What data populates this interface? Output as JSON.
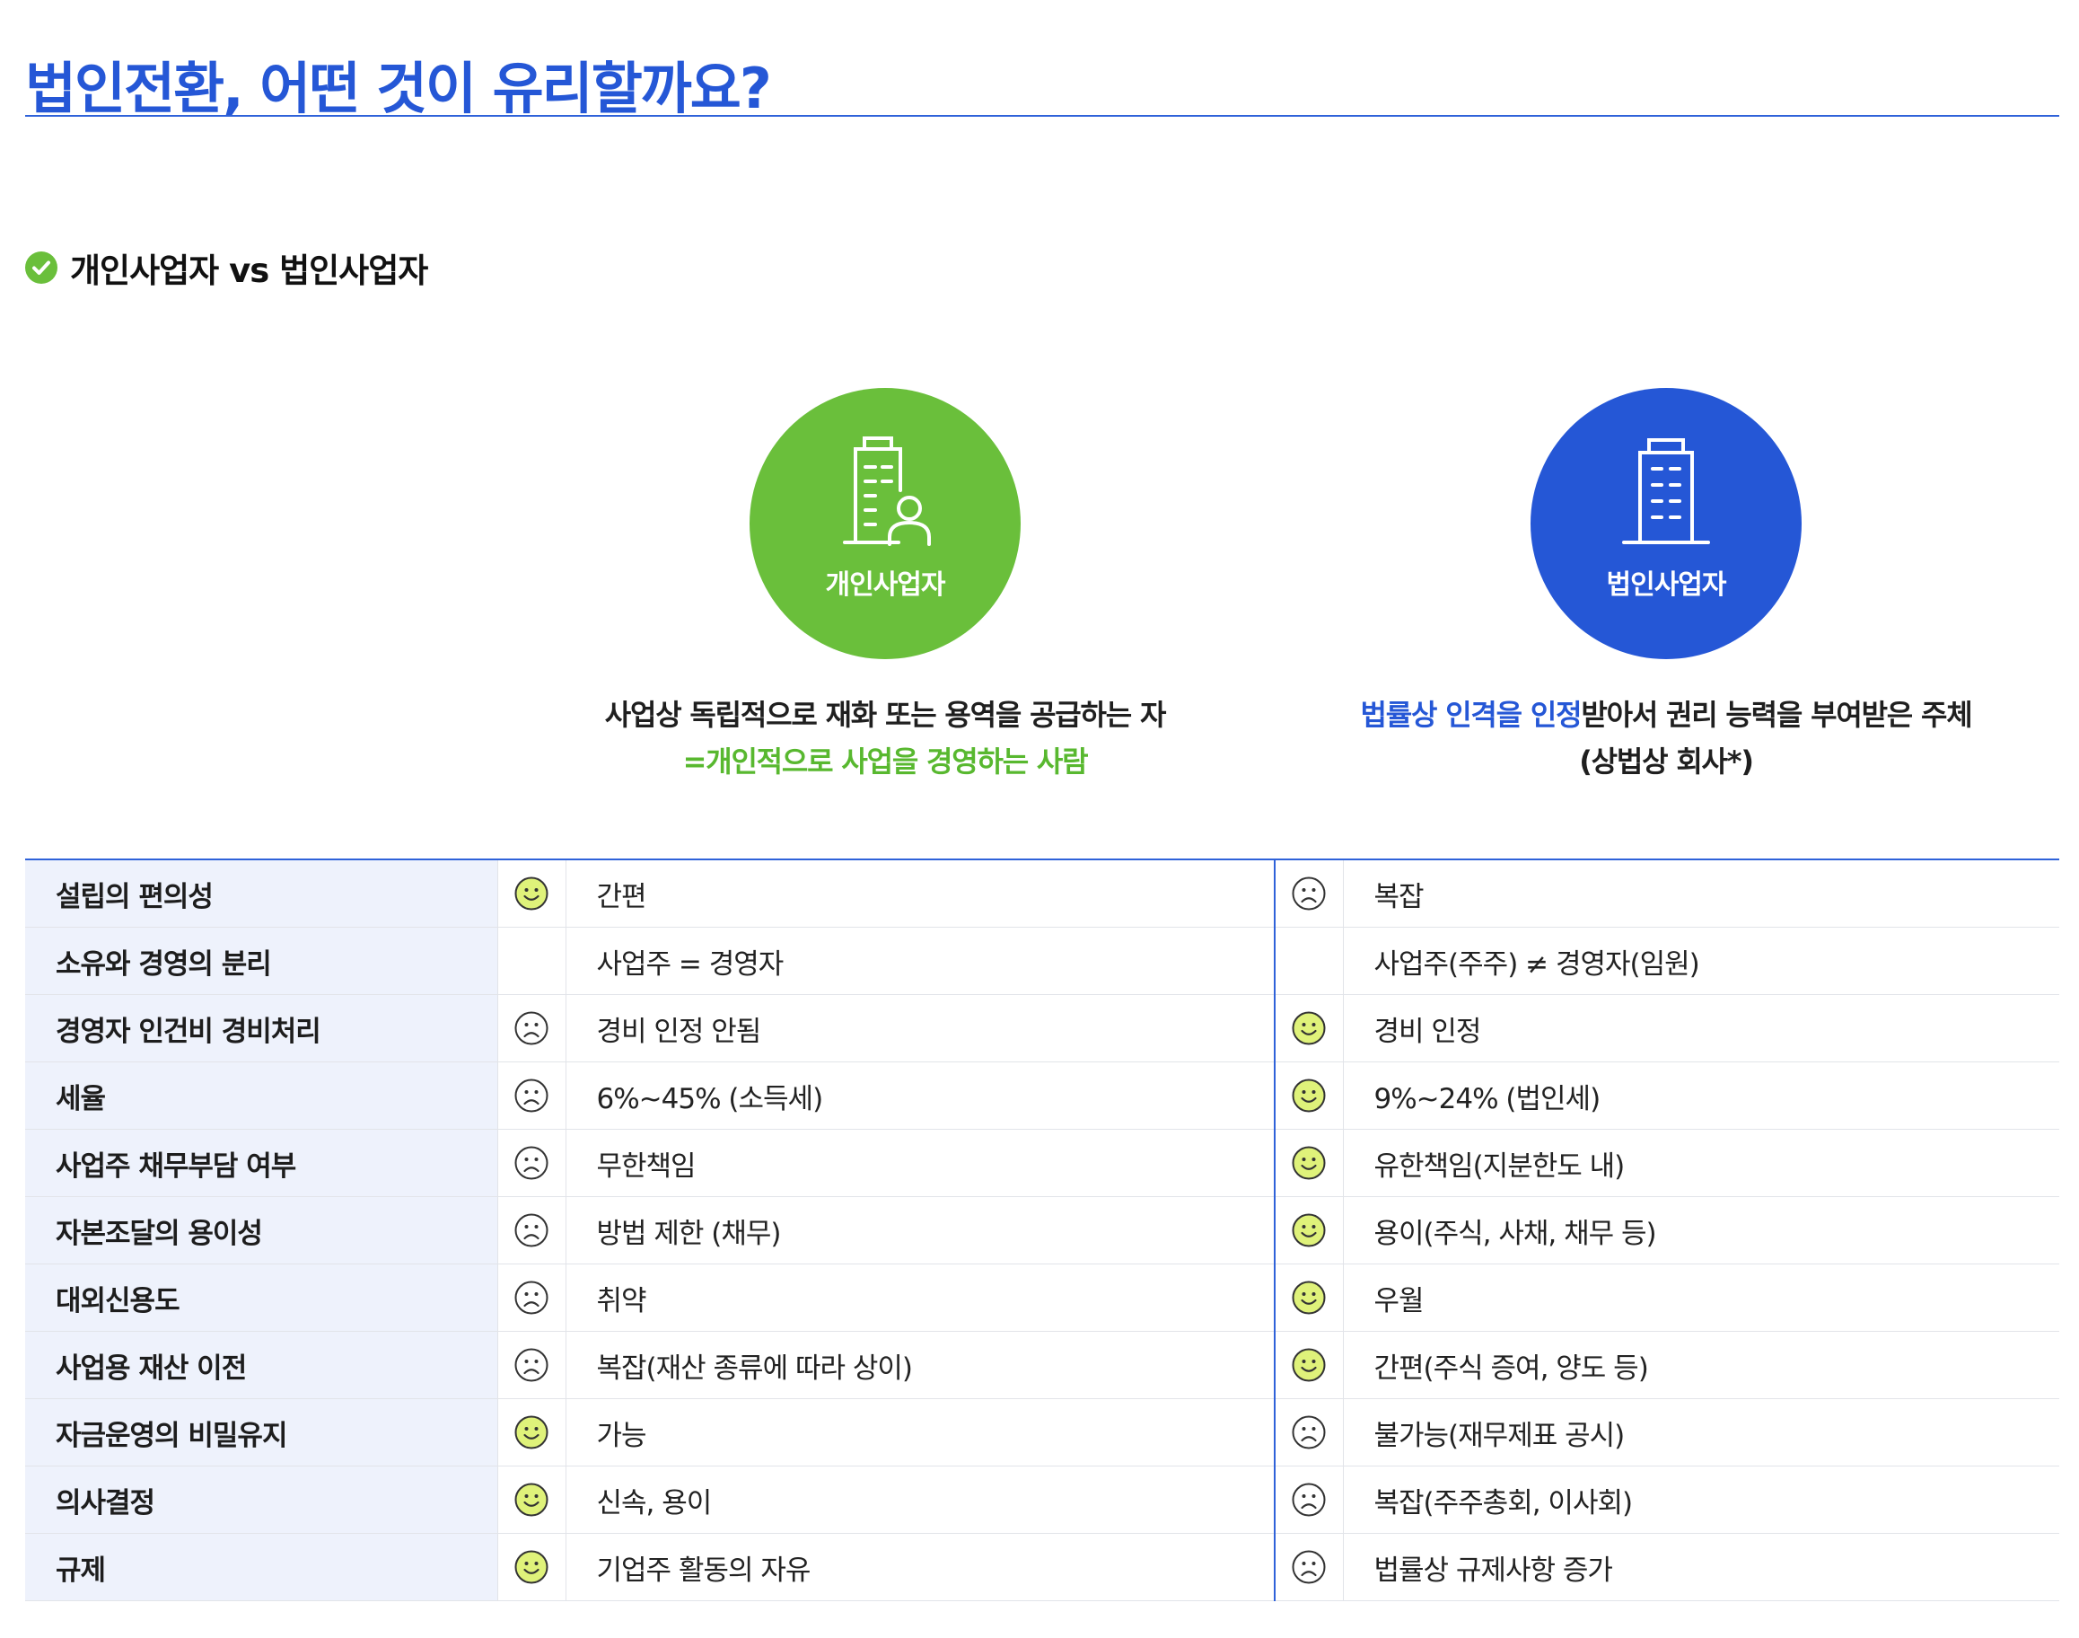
{
  "page": {
    "title": "법인전환, 어떤 것이 유리할까요?",
    "section_heading": "개인사업자 vs 법인사업자"
  },
  "colors": {
    "primary_blue": "#2557d6",
    "green": "#6abf3b",
    "label_background": "#eef2fc",
    "face_yellow": "#dff27a"
  },
  "individual": {
    "circle_label": "개인사업자",
    "icon": "building-with-person-icon",
    "description_line1": "사업상 독립적으로 재화 또는 용역을 공급하는 자",
    "description_line2": "=개인적으로 사업을 경영하는 사람"
  },
  "corporate": {
    "circle_label": "법인사업자",
    "icon": "office-building-icon",
    "description_highlight": "법률상 인격을 인정",
    "description_rest": "받아서 권리 능력을 부여받은 주체",
    "description_line2": "(상법상 회사*)"
  },
  "comparison": {
    "rows": [
      {
        "label": "설립의 편의성",
        "individual_face": "happy",
        "individual": "간편",
        "corporate_face": "sad",
        "corporate": "복잡"
      },
      {
        "label": "소유와 경영의 분리",
        "individual_face": "none",
        "individual": "사업주 = 경영자",
        "corporate_face": "none",
        "corporate": "사업주(주주) ≠ 경영자(임원)"
      },
      {
        "label": "경영자 인건비 경비처리",
        "individual_face": "sad",
        "individual": "경비 인정 안됨",
        "corporate_face": "happy",
        "corporate": "경비 인정"
      },
      {
        "label": "세율",
        "individual_face": "sad",
        "individual": "6%~45% (소득세)",
        "corporate_face": "happy",
        "corporate": "9%~24% (법인세)"
      },
      {
        "label": "사업주 채무부담 여부",
        "individual_face": "sad",
        "individual": "무한책임",
        "corporate_face": "happy",
        "corporate": "유한책임(지분한도 내)"
      },
      {
        "label": "자본조달의 용이성",
        "individual_face": "sad",
        "individual": "방법 제한 (채무)",
        "corporate_face": "happy",
        "corporate": "용이(주식, 사채, 채무 등)"
      },
      {
        "label": "대외신용도",
        "individual_face": "sad",
        "individual": "취약",
        "corporate_face": "happy",
        "corporate": "우월"
      },
      {
        "label": "사업용 재산 이전",
        "individual_face": "sad",
        "individual": "복잡(재산 종류에 따라 상이)",
        "corporate_face": "happy",
        "corporate": "간편(주식 증여, 양도 등)"
      },
      {
        "label": "자금운영의 비밀유지",
        "individual_face": "happy",
        "individual": "가능",
        "corporate_face": "sad",
        "corporate": "불가능(재무제표 공시)"
      },
      {
        "label": "의사결정",
        "individual_face": "happy",
        "individual": "신속, 용이",
        "corporate_face": "sad",
        "corporate": "복잡(주주총회, 이사회)"
      },
      {
        "label": "규제",
        "individual_face": "happy",
        "individual": "기업주 활동의 자유",
        "corporate_face": "sad",
        "corporate": "법률상 규제사항 증가"
      }
    ]
  }
}
